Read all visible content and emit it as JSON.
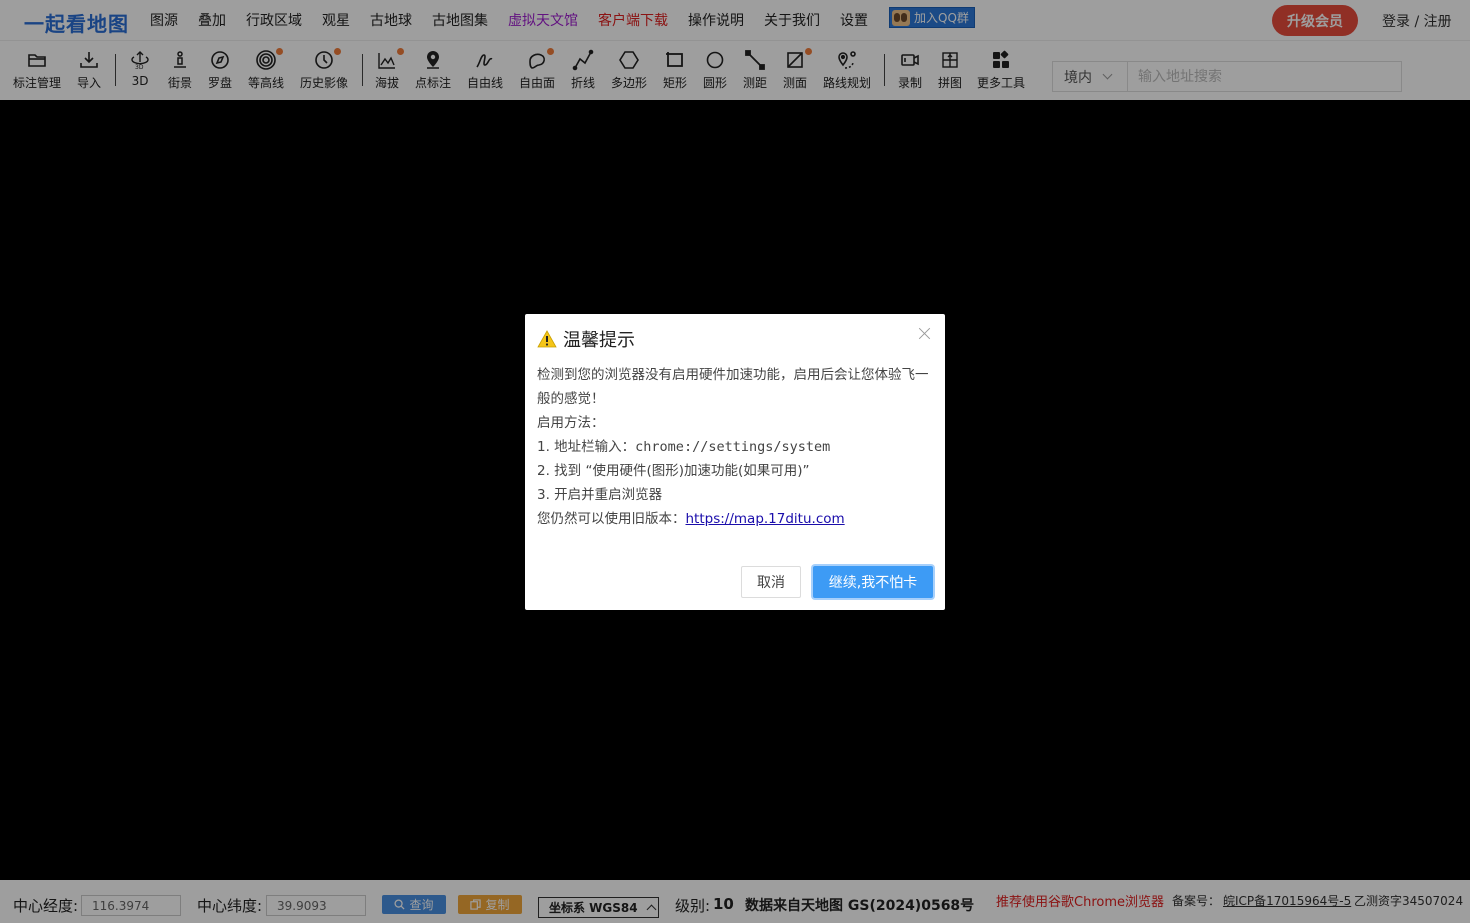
{
  "brand": {
    "logo_text": "一起看地图"
  },
  "menu": [
    {
      "label": "图源",
      "style": "normal"
    },
    {
      "label": "叠加",
      "style": "normal"
    },
    {
      "label": "行政区域",
      "style": "normal"
    },
    {
      "label": "观星",
      "style": "normal"
    },
    {
      "label": "古地球",
      "style": "normal"
    },
    {
      "label": "古地图集",
      "style": "normal"
    },
    {
      "label": "虚拟天文馆",
      "style": "purple"
    },
    {
      "label": "客户端下载",
      "style": "red"
    },
    {
      "label": "操作说明",
      "style": "normal"
    },
    {
      "label": "关于我们",
      "style": "normal"
    },
    {
      "label": "设置",
      "style": "normal"
    }
  ],
  "qq_button": {
    "label": "加入QQ群"
  },
  "upgrade_button": {
    "label": "升级会员"
  },
  "login_link": {
    "label": "登录 / 注册"
  },
  "toolbar": {
    "tools": [
      {
        "label": "标注管理",
        "icon": "folder-icon",
        "badge": false
      },
      {
        "label": "导入",
        "icon": "download-icon",
        "badge": false
      },
      {
        "label": "3D",
        "icon": "3d-rotate-icon",
        "badge": false
      },
      {
        "label": "街景",
        "icon": "pegman-icon",
        "badge": false
      },
      {
        "label": "罗盘",
        "icon": "compass-icon",
        "badge": false
      },
      {
        "label": "等高线",
        "icon": "contour-icon",
        "badge": true
      },
      {
        "label": "历史影像",
        "icon": "clock-icon",
        "badge": true
      },
      {
        "label": "海拔",
        "icon": "elevation-icon",
        "badge": true
      },
      {
        "label": "点标注",
        "icon": "map-pin-icon",
        "badge": false
      },
      {
        "label": "自由线",
        "icon": "freehand-line-icon",
        "badge": false
      },
      {
        "label": "自由面",
        "icon": "freehand-area-icon",
        "badge": true
      },
      {
        "label": "折线",
        "icon": "polyline-icon",
        "badge": false
      },
      {
        "label": "多边形",
        "icon": "polygon-icon",
        "badge": false
      },
      {
        "label": "矩形",
        "icon": "rectangle-icon",
        "badge": false
      },
      {
        "label": "圆形",
        "icon": "circle-icon",
        "badge": false
      },
      {
        "label": "测距",
        "icon": "measure-distance-icon",
        "badge": false
      },
      {
        "label": "测面",
        "icon": "measure-area-icon",
        "badge": true
      },
      {
        "label": "路线规划",
        "icon": "route-icon",
        "badge": false
      },
      {
        "label": "录制",
        "icon": "record-icon",
        "badge": false
      },
      {
        "label": "拼图",
        "icon": "mosaic-icon",
        "badge": false
      },
      {
        "label": "更多工具",
        "icon": "more-tools-icon",
        "badge": false
      }
    ],
    "region_select": {
      "value": "境内"
    },
    "search": {
      "placeholder": "输入地址搜索"
    }
  },
  "dialog": {
    "title": "温馨提示",
    "line1": "检测到您的浏览器没有启用硬件加速功能，启用后会让您体验飞一般的感觉！",
    "line2": "启用方法：",
    "step1_prefix": "1. 地址栏输入：",
    "step1_code": "chrome://settings/system",
    "step2": "2. 找到 “使用硬件(图形)加速功能(如果可用)”",
    "step3": "3. 开启并重启浏览器",
    "legacy_prefix": "您仍然可以使用旧版本：",
    "legacy_link": "https://map.17ditu.com",
    "cancel_label": "取消",
    "continue_label": "继续,我不怕卡"
  },
  "statusbar": {
    "lon_label": "中心经度:",
    "lon_value": "116.3974",
    "lat_label": "中心纬度:",
    "lat_value": "39.9093",
    "query_label": "查询",
    "copy_label": "复制",
    "crs_label": "坐标系 WGS84",
    "level_label": "级别:",
    "level_value": "10",
    "source_text": "数据来自天地图 GS(2024)0568号",
    "chrome_tip": "推荐使用谷歌Chrome浏览器",
    "icp_label": "备案号：",
    "icp_value": "皖ICP备17015964号-5",
    "survey_text": "乙测资字34507024"
  },
  "colors": {
    "brand_blue": "#2a6fd6",
    "upgrade_red": "#e84c3d",
    "primary_button": "#3d9bf5",
    "badge_orange": "#f07c3b"
  }
}
